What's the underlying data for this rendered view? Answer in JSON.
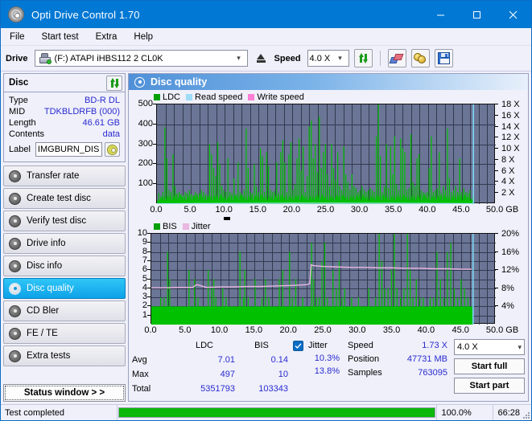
{
  "window": {
    "title": "Opti Drive Control 1.70",
    "app_icon": "disc-icon",
    "minimize": "minimize-icon",
    "maximize": "maximize-icon",
    "close": "close-icon"
  },
  "menu": [
    {
      "label": "File"
    },
    {
      "label": "Start test"
    },
    {
      "label": "Extra"
    },
    {
      "label": "Help"
    }
  ],
  "toolbar": {
    "drive_label": "Drive",
    "drive_value": "(F:)  ATAPI iHBS112  2 CL0K",
    "eject_icon": "eject-icon",
    "speed_label": "Speed",
    "speed_value": "4.0 X",
    "refresh_icon": "refresh-icon",
    "eraser_icon": "eraser-icon",
    "bell_icon": "bell-icon",
    "save_icon": "save-icon"
  },
  "disc": {
    "header": "Disc",
    "refresh_icon": "refresh-icon",
    "rows": [
      {
        "key": "Type",
        "value": "BD-R DL"
      },
      {
        "key": "MID",
        "value": "TDKBLDRFB (000)"
      },
      {
        "key": "Length",
        "value": "46.61 GB"
      },
      {
        "key": "Contents",
        "value": "data"
      }
    ],
    "label_key": "Label",
    "label_value": "IMGBURN_DIS",
    "label_icon": "cd-icon"
  },
  "nav": {
    "items": [
      {
        "label": "Transfer rate",
        "active": false
      },
      {
        "label": "Create test disc",
        "active": false
      },
      {
        "label": "Verify test disc",
        "active": false
      },
      {
        "label": "Drive info",
        "active": false
      },
      {
        "label": "Disc info",
        "active": false
      },
      {
        "label": "Disc quality",
        "active": true
      },
      {
        "label": "CD Bler",
        "active": false
      },
      {
        "label": "FE / TE",
        "active": false
      },
      {
        "label": "Extra tests",
        "active": false
      }
    ],
    "status_window": "Status window > >"
  },
  "panel": {
    "title": "Disc quality",
    "icon": "disc-quality-icon"
  },
  "chart_data": [
    {
      "id": "ldc-chart",
      "type": "line",
      "title": "",
      "xlabel": "GB",
      "ylabel": "LDC",
      "legend": [
        {
          "name": "LDC",
          "color": "#00a000"
        },
        {
          "name": "Read speed",
          "color": "#9fdcf5"
        },
        {
          "name": "Write speed",
          "color": "#ff7fd4"
        }
      ],
      "legend_position": "top-left",
      "grid": true,
      "xlim": [
        0,
        50
      ],
      "xticks": [
        "0.0",
        "5.0",
        "10.0",
        "15.0",
        "20.0",
        "25.0",
        "30.0",
        "35.0",
        "40.0",
        "45.0",
        "50.0"
      ],
      "xunit": "GB",
      "ylim": [
        0,
        500
      ],
      "yticks": [
        100,
        200,
        300,
        400,
        500
      ],
      "y2lim": [
        0,
        18
      ],
      "y2ticks": [
        "2 X",
        "4 X",
        "6 X",
        "8 X",
        "10 X",
        "12 X",
        "14 X",
        "16 X",
        "18 X"
      ],
      "series": [
        {
          "name": "LDC",
          "color": "#00c000",
          "kind": "spikes",
          "x": [
            0.2,
            0.5,
            0.8,
            1.1,
            1.4,
            1.7,
            2.0,
            2.3,
            2.6,
            2.9,
            3.2,
            3.5,
            3.8,
            4.1,
            4.4,
            4.7,
            5.0,
            5.3,
            5.6,
            5.9,
            6.2,
            6.5,
            6.8,
            7.1,
            7.4,
            7.7,
            8.0,
            8.3,
            8.6,
            8.9,
            9.2,
            9.5,
            9.8,
            10.1,
            10.4,
            10.7,
            11.0,
            11.3,
            11.6,
            11.9,
            12.2,
            12.5,
            12.8,
            13.1,
            13.4,
            13.7,
            14.0,
            14.3,
            14.6,
            14.9,
            15.2,
            15.5,
            15.8,
            16.1,
            16.4,
            16.7,
            17.0,
            17.3,
            17.6,
            17.9,
            18.2,
            18.5,
            18.8,
            19.1,
            19.4,
            19.7,
            20.0,
            20.3,
            20.6,
            20.9,
            21.2,
            21.5,
            21.8,
            22.1,
            22.4,
            22.7,
            23.0,
            23.3,
            23.6,
            23.9,
            24.2,
            24.5,
            24.8,
            25.1,
            25.4,
            25.7,
            26.0,
            26.3,
            26.6,
            26.9,
            27.2,
            27.5,
            27.8,
            28.1,
            28.4,
            28.7,
            29.0,
            29.3,
            29.6,
            29.9,
            30.2,
            30.5,
            30.8,
            31.1,
            31.4,
            31.7,
            32.0,
            32.3,
            32.6,
            32.9,
            33.2,
            33.5,
            33.8,
            34.1,
            34.4,
            34.7,
            35.0,
            35.3,
            35.6,
            35.9,
            36.2,
            36.5,
            36.8,
            37.1,
            37.4,
            37.7,
            38.0,
            38.3,
            38.6,
            38.9,
            39.2,
            39.5,
            39.8,
            40.1,
            40.4,
            40.7,
            41.0,
            41.3,
            41.6,
            41.9,
            42.2,
            42.5,
            42.8,
            43.1,
            43.4,
            43.7,
            44.0,
            44.3,
            44.6,
            44.9,
            45.2,
            45.5,
            45.8,
            46.1,
            46.4,
            46.7
          ],
          "values": [
            55,
            40,
            60,
            385,
            230,
            70,
            60,
            250,
            90,
            55,
            60,
            50,
            45,
            60,
            55,
            70,
            50,
            45,
            60,
            50,
            55,
            70,
            60,
            50,
            45,
            300,
            250,
            180,
            140,
            310,
            200,
            90,
            70,
            60,
            230,
            60,
            55,
            130,
            50,
            210,
            60,
            50,
            70,
            380,
            180,
            60,
            55,
            200,
            90,
            60,
            280,
            240,
            60,
            260,
            190,
            70,
            60,
            65,
            210,
            55,
            260,
            320,
            210,
            60,
            250,
            310,
            70,
            100,
            230,
            330,
            170,
            290,
            60,
            140,
            390,
            420,
            230,
            300,
            160,
            440,
            180,
            260,
            300,
            150,
            90,
            300,
            180,
            120,
            260,
            90,
            70,
            290,
            150,
            110,
            70,
            150,
            90,
            80,
            60,
            70,
            90,
            70,
            60,
            70,
            80,
            70,
            60,
            340,
            500,
            240,
            60,
            90,
            300,
            80,
            290,
            150,
            340,
            100,
            70,
            330,
            280,
            260,
            70,
            80,
            350,
            110,
            90,
            230,
            250,
            70,
            60,
            55,
            60,
            180,
            340,
            60,
            70,
            80,
            260,
            55,
            90,
            70,
            380,
            130,
            60,
            70,
            90,
            60,
            230,
            60,
            80,
            60,
            55,
            70
          ]
        },
        {
          "name": "Read speed",
          "color": "#a8e1f7",
          "kind": "line",
          "x": [
            0,
            2,
            4,
            6,
            8,
            10,
            12,
            14,
            16,
            18,
            20,
            22,
            23.5,
            25,
            27,
            29,
            31,
            33,
            35,
            37,
            39,
            41,
            43,
            45,
            46.7
          ],
          "values": [
            1.7,
            1.9,
            2.2,
            2.5,
            2.8,
            3.0,
            3.2,
            3.4,
            3.6,
            3.8,
            4.0,
            4.1,
            4.2,
            4.1,
            4.0,
            3.9,
            3.7,
            3.6,
            3.5,
            3.3,
            3.1,
            2.8,
            2.5,
            2.1,
            1.8
          ]
        },
        {
          "name": "Write speed",
          "color": "#ff7fd4",
          "kind": "line",
          "x": [],
          "values": []
        }
      ],
      "end_marker_x": 46.7
    },
    {
      "id": "bis-chart",
      "type": "line",
      "title": "",
      "xlabel": "GB",
      "ylabel": "BIS",
      "legend": [
        {
          "name": "BIS",
          "color": "#00a000"
        },
        {
          "name": "Jitter",
          "color": "#e9b7e0"
        }
      ],
      "legend_position": "top-left",
      "grid": true,
      "xlim": [
        0,
        50
      ],
      "xticks": [
        "0.0",
        "5.0",
        "10.0",
        "15.0",
        "20.0",
        "25.0",
        "30.0",
        "35.0",
        "40.0",
        "45.0",
        "50.0"
      ],
      "xunit": "GB",
      "ylim": [
        0,
        10
      ],
      "yticks": [
        1,
        2,
        3,
        4,
        5,
        6,
        7,
        8,
        9,
        10
      ],
      "y2lim": [
        0,
        20
      ],
      "y2ticks": [
        "4%",
        "8%",
        "12%",
        "16%",
        "20%"
      ],
      "series": [
        {
          "name": "BIS",
          "color": "#00c000",
          "kind": "spikes",
          "x": [
            0.3,
            0.8,
            1.3,
            1.8,
            2.3,
            2.6,
            2.9,
            3.4,
            3.9,
            4.4,
            4.9,
            5.4,
            5.9,
            6.2,
            6.7,
            7.2,
            7.7,
            8.2,
            8.7,
            9.0,
            9.3,
            9.8,
            10.3,
            10.8,
            11.3,
            11.8,
            12.3,
            12.8,
            13.3,
            13.5,
            14.0,
            14.5,
            15.0,
            15.5,
            16.0,
            16.5,
            17.0,
            17.5,
            18.0,
            18.5,
            19.0,
            19.5,
            20.0,
            20.4,
            20.9,
            21.4,
            21.9,
            22.4,
            22.9,
            23.2,
            23.5,
            23.9,
            24.3,
            24.7,
            25.1,
            25.5,
            25.9,
            26.3,
            26.8,
            27.2,
            27.6,
            28.0,
            28.5,
            29.0,
            29.5,
            30.0,
            30.5,
            31.0,
            31.5,
            32.0,
            32.5,
            33.0,
            33.4,
            33.8,
            34.3,
            34.8,
            35.2,
            35.6,
            36.1,
            36.6,
            37.1,
            37.5,
            37.9,
            38.4,
            38.9,
            39.4,
            39.9,
            40.4,
            40.9,
            41.4,
            41.9,
            42.4,
            42.9,
            43.4,
            43.9,
            44.4,
            44.9,
            45.4,
            45.9,
            46.4
          ],
          "values": [
            2,
            2,
            3,
            3,
            8,
            5,
            2,
            2,
            2,
            2,
            2,
            6,
            2,
            5,
            3,
            2,
            2,
            6,
            4,
            5,
            3,
            2,
            4,
            3,
            2,
            2,
            2,
            8,
            3,
            6,
            3,
            2,
            5,
            2,
            3,
            5,
            3,
            2,
            2,
            5,
            6,
            2,
            8,
            3,
            5,
            2,
            3,
            2,
            2,
            9,
            5,
            3,
            3,
            7,
            9,
            3,
            2,
            6,
            4,
            7,
            3,
            4,
            2,
            3,
            2,
            3,
            2,
            2,
            4,
            2,
            3,
            10,
            7,
            4,
            4,
            6,
            10,
            4,
            3,
            4,
            10,
            6,
            3,
            5,
            3,
            3,
            2,
            3,
            3,
            8,
            5,
            3,
            8,
            9,
            4,
            3,
            5,
            4,
            3,
            2
          ]
        },
        {
          "name": "Jitter",
          "color": "#e9b7e0",
          "kind": "line",
          "x": [
            0,
            2,
            4,
            6,
            6.6,
            8,
            10,
            12,
            14,
            16,
            18,
            20,
            21.5,
            22.5,
            23.0,
            23.2,
            23.5,
            25,
            27,
            29,
            31,
            33,
            35,
            37,
            39,
            41,
            43,
            45,
            46.5
          ],
          "values": [
            4.05,
            4.05,
            4.1,
            4.1,
            4.4,
            4.1,
            4.15,
            4.15,
            4.2,
            4.2,
            4.25,
            4.3,
            4.35,
            4.4,
            4.5,
            6.6,
            6.5,
            6.4,
            6.35,
            6.3,
            6.3,
            6.25,
            6.25,
            6.2,
            6.2,
            6.15,
            6.15,
            6.1,
            6.1
          ]
        }
      ],
      "end_marker_x": 46.7
    }
  ],
  "stats": {
    "col_headers": [
      "LDC",
      "BIS"
    ],
    "rows": [
      {
        "key": "Avg",
        "ldc": "7.01",
        "bis": "0.14"
      },
      {
        "key": "Max",
        "ldc": "497",
        "bis": "10"
      },
      {
        "key": "Total",
        "ldc": "5351793",
        "bis": "103343"
      }
    ],
    "jitter": {
      "checkbox_checked": true,
      "label": "Jitter",
      "avg": "10.3%",
      "max": "13.8%"
    },
    "speed_key": "Speed",
    "speed_value": "1.73 X",
    "position_key": "Position",
    "position_value": "47731 MB",
    "samples_key": "Samples",
    "samples_value": "763095",
    "speed_select": "4.0 X",
    "start_full": "Start full",
    "start_part": "Start part"
  },
  "statusbar": {
    "text": "Test completed",
    "progress_percent": 100,
    "progress_label": "100.0%",
    "time": "66:28"
  },
  "colors": {
    "accent": "#0078d4",
    "plot_bg": "#6b7596",
    "green": "#00c000",
    "read_speed": "#a8e1f7",
    "write_speed": "#ff7fd4",
    "jitter": "#e9b7e0",
    "value_text": "#2a2ad0",
    "progress": "#0bb80b"
  }
}
